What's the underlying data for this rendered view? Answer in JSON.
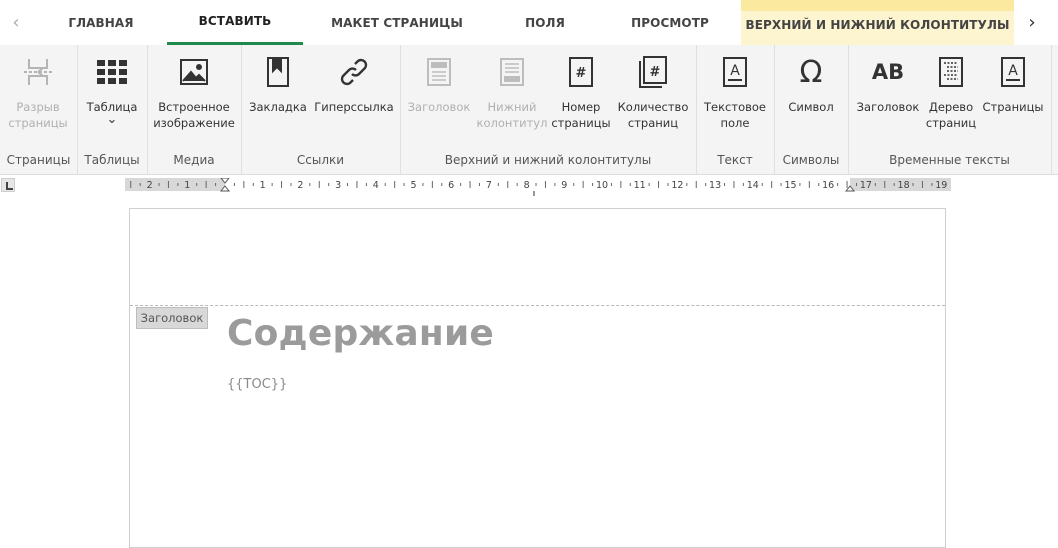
{
  "tabs": {
    "nav_left": "‹",
    "nav_right": "›",
    "items": [
      {
        "label": "ГЛАВНАЯ"
      },
      {
        "label": "ВСТАВИТЬ"
      },
      {
        "label": "МАКЕТ СТРАНИЦЫ"
      },
      {
        "label": "ПОЛЯ"
      },
      {
        "label": "ПРОСМОТР"
      },
      {
        "label": "ВЕРХНИЙ И НИЖНИЙ КОЛОНТИТУЛЫ"
      }
    ],
    "active": "ВСТАВИТЬ"
  },
  "ribbon": {
    "groups": [
      {
        "label": "Страницы",
        "buttons": [
          {
            "label": "Разрыв\nстраницы",
            "icon": "page-break-icon",
            "disabled": true
          }
        ]
      },
      {
        "label": "Таблицы",
        "buttons": [
          {
            "label": "Таблица",
            "icon": "table-grid-icon",
            "dropdown": "⌄"
          }
        ]
      },
      {
        "label": "Медиа",
        "buttons": [
          {
            "label": "Встроенное\nизображение",
            "icon": "image-icon"
          }
        ]
      },
      {
        "label": "Ссылки",
        "buttons": [
          {
            "label": "Закладка",
            "icon": "bookmark-icon"
          },
          {
            "label": "Гиперссылка",
            "icon": "link-icon"
          }
        ]
      },
      {
        "label": "Верхний и нижний колонтитулы",
        "buttons": [
          {
            "label": "Заголовок",
            "icon": "header-icon",
            "disabled": true
          },
          {
            "label": "Нижний\nколонтитул",
            "icon": "footer-icon",
            "disabled": true
          },
          {
            "label": "Номер\nстраницы",
            "icon": "page-number-icon"
          },
          {
            "label": "Количество\nстраниц",
            "icon": "page-count-icon"
          }
        ]
      },
      {
        "label": "Текст",
        "buttons": [
          {
            "label": "Текстовое\nполе",
            "icon": "text-box-icon"
          }
        ]
      },
      {
        "label": "Символы",
        "buttons": [
          {
            "label": "Символ",
            "icon": "omega-icon",
            "glyph": "Ω"
          }
        ]
      },
      {
        "label": "Временные тексты",
        "buttons": [
          {
            "label": "Заголовок",
            "icon": "heading-ab-icon",
            "glyph": "AB"
          },
          {
            "label": "Дерево\nстраниц",
            "icon": "page-tree-icon"
          },
          {
            "label": "Страницы",
            "icon": "pages-icon"
          }
        ]
      }
    ]
  },
  "ruler": {
    "labels": [
      "2",
      "1",
      "1",
      "2",
      "3",
      "4",
      "5",
      "6",
      "7",
      "8",
      "9",
      "10",
      "11",
      "12",
      "13",
      "14",
      "15",
      "16",
      "17",
      "18",
      "19"
    ]
  },
  "document": {
    "header_tag": "Заголовок",
    "title": "Содержание",
    "toc_placeholder": "{{TOC}}"
  },
  "colors": {
    "accent": "#1e8a4c",
    "context_tab": "#fdf4d0",
    "ribbon_bg": "#f4f4f4",
    "title_text": "#9b9b9b"
  }
}
